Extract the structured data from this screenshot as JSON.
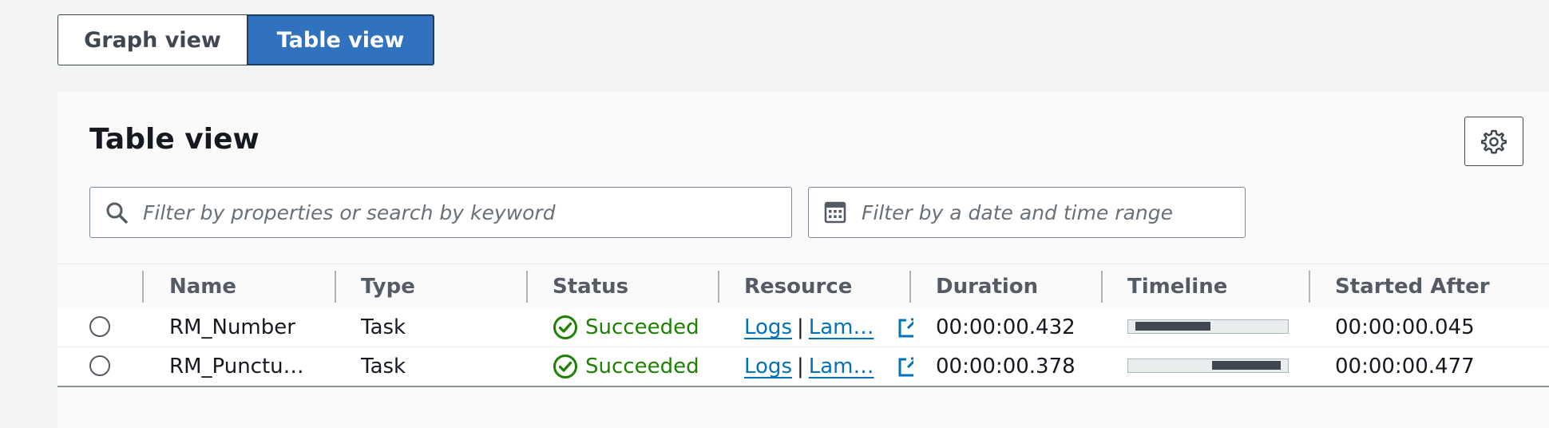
{
  "view_toggle": {
    "graph_label": "Graph view",
    "table_label": "Table view"
  },
  "panel": {
    "title": "Table view",
    "settings_icon": "gear-icon"
  },
  "filters": {
    "search_placeholder": "Filter by properties or search by keyword",
    "search_icon": "search-icon",
    "date_placeholder": "Filter by a date and time range",
    "date_icon": "calendar-icon"
  },
  "table": {
    "columns": [
      "Name",
      "Type",
      "Status",
      "Resource",
      "Duration",
      "Timeline",
      "Started After"
    ],
    "rows": [
      {
        "name": "RM_Number",
        "type": "Task",
        "status": "Succeeded",
        "resource_logs": "Logs",
        "resource_separator": "|",
        "resource_lambda": "Lam…",
        "duration": "00:00:00.432",
        "timeline_start_fraction": 0.045,
        "timeline_end_fraction": 0.52,
        "started_after": "00:00:00.045"
      },
      {
        "name": "RM_Punctu…",
        "type": "Task",
        "status": "Succeeded",
        "resource_logs": "Logs",
        "resource_separator": "|",
        "resource_lambda": "Lam…",
        "duration": "00:00:00.378",
        "timeline_start_fraction": 0.53,
        "timeline_end_fraction": 0.96,
        "started_after": "00:00:00.477"
      }
    ]
  },
  "colors": {
    "accent": "#3072bd",
    "success": "#1d8102",
    "link": "#0073bb"
  }
}
